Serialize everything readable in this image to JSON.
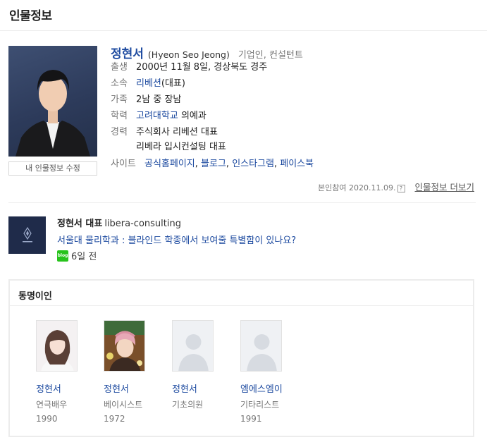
{
  "header": {
    "title": "인물정보"
  },
  "profile": {
    "name": "정현서",
    "name_en": "(Hyeon Seo Jeong)",
    "job": "기업인, 컨설턴트",
    "edit_button": "내 인물정보 수정",
    "rows": {
      "birth": {
        "label": "출생",
        "value": "2000년 11월 8일, 경상북도 경주"
      },
      "affiliation": {
        "label": "소속",
        "link": "리베션",
        "suffix": "(대표)"
      },
      "family": {
        "label": "가족",
        "value": "2남 중 장남"
      },
      "education": {
        "label": "학력",
        "link": "고려대학교",
        "suffix": " 의예과"
      },
      "career": {
        "label": "경력",
        "line1": "주식회사 리베션 대표",
        "line2": "리베라 입시컨설팅 대표"
      },
      "site": {
        "label": "사이트",
        "links": [
          "공식홈페이지",
          "블로그",
          "인스타그램",
          "페이스북"
        ],
        "sep": ", "
      }
    },
    "meta": {
      "participation": "본인참여 2020.11.09.",
      "help": "?",
      "more": "인물정보 더보기"
    }
  },
  "blog": {
    "author": "정현서 대표",
    "source": "libera-consulting",
    "title": "서울대 물리학과 : 블라인드 학종에서 보여줄 특별함이 있나요?",
    "badge": "blog",
    "time": "6일 전"
  },
  "same_name": {
    "title": "동명이인",
    "people": [
      {
        "name": "정현서",
        "job": "연극배우",
        "year": "1990"
      },
      {
        "name": "정현서",
        "job": "베이시스트",
        "year": "1972"
      },
      {
        "name": "정현서",
        "job": "기초의원",
        "year": ""
      },
      {
        "name": "엠에스엠이",
        "job": "기타리스트",
        "year": "1991"
      }
    ]
  },
  "colors": {
    "link": "#1e4ba0",
    "blog_badge": "#27c31c",
    "photo_bg": "#2d3b5b"
  }
}
